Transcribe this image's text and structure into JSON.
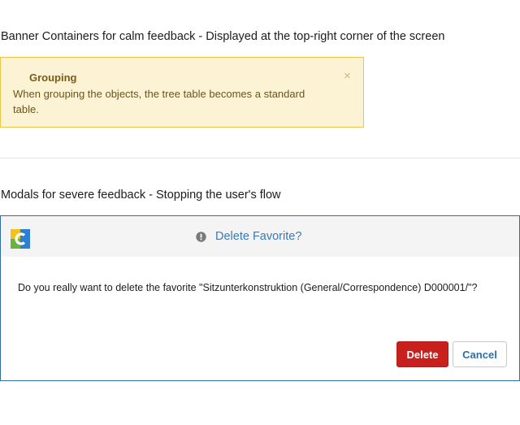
{
  "sections": {
    "banners_heading": "Banner Containers for calm feedback - Displayed at the top-right corner of the screen",
    "modals_heading": "Modals for severe feedback - Stopping the user's flow"
  },
  "banner": {
    "title": "Grouping",
    "text": "When grouping the objects, the tree table becomes a standard table.",
    "close_symbol": "×",
    "close_icon": "close-icon",
    "colors": {
      "background": "#fbf3d4",
      "border": "#e9c54a",
      "text": "#6e5418"
    }
  },
  "modal": {
    "logo_icon": "app-logo-icon",
    "status_icon": "info-icon",
    "title": "Delete Favorite?",
    "message": "Do you really want to delete the favorite \"Sitzunterkonstruktion (General/Correspondence) D000001/\"?",
    "buttons": {
      "delete_label": "Delete",
      "cancel_label": "Cancel"
    },
    "colors": {
      "border": "#2f6ea8",
      "title": "#3c78b8",
      "delete": "#c8201c"
    }
  }
}
